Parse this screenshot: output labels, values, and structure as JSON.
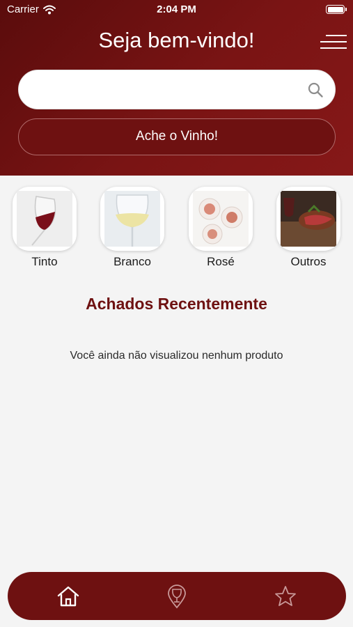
{
  "status_bar": {
    "carrier": "Carrier",
    "time": "2:04 PM"
  },
  "header": {
    "title": "Seja bem-vindo!"
  },
  "search": {
    "placeholder": "",
    "value": "",
    "button_label": "Ache o Vinho!"
  },
  "categories": [
    {
      "label": "Tinto"
    },
    {
      "label": "Branco"
    },
    {
      "label": "Rosé"
    },
    {
      "label": "Outros"
    }
  ],
  "recent": {
    "title": "Achados Recentemente",
    "empty_message": "Você ainda não visualizou nenhum produto"
  },
  "bottom_nav": {
    "items": [
      "home-icon",
      "wine-glass-location-icon",
      "star-icon"
    ]
  },
  "colors": {
    "brand": "#6e1111",
    "header_dark": "#5a0c0c",
    "background": "#f4f4f4"
  }
}
